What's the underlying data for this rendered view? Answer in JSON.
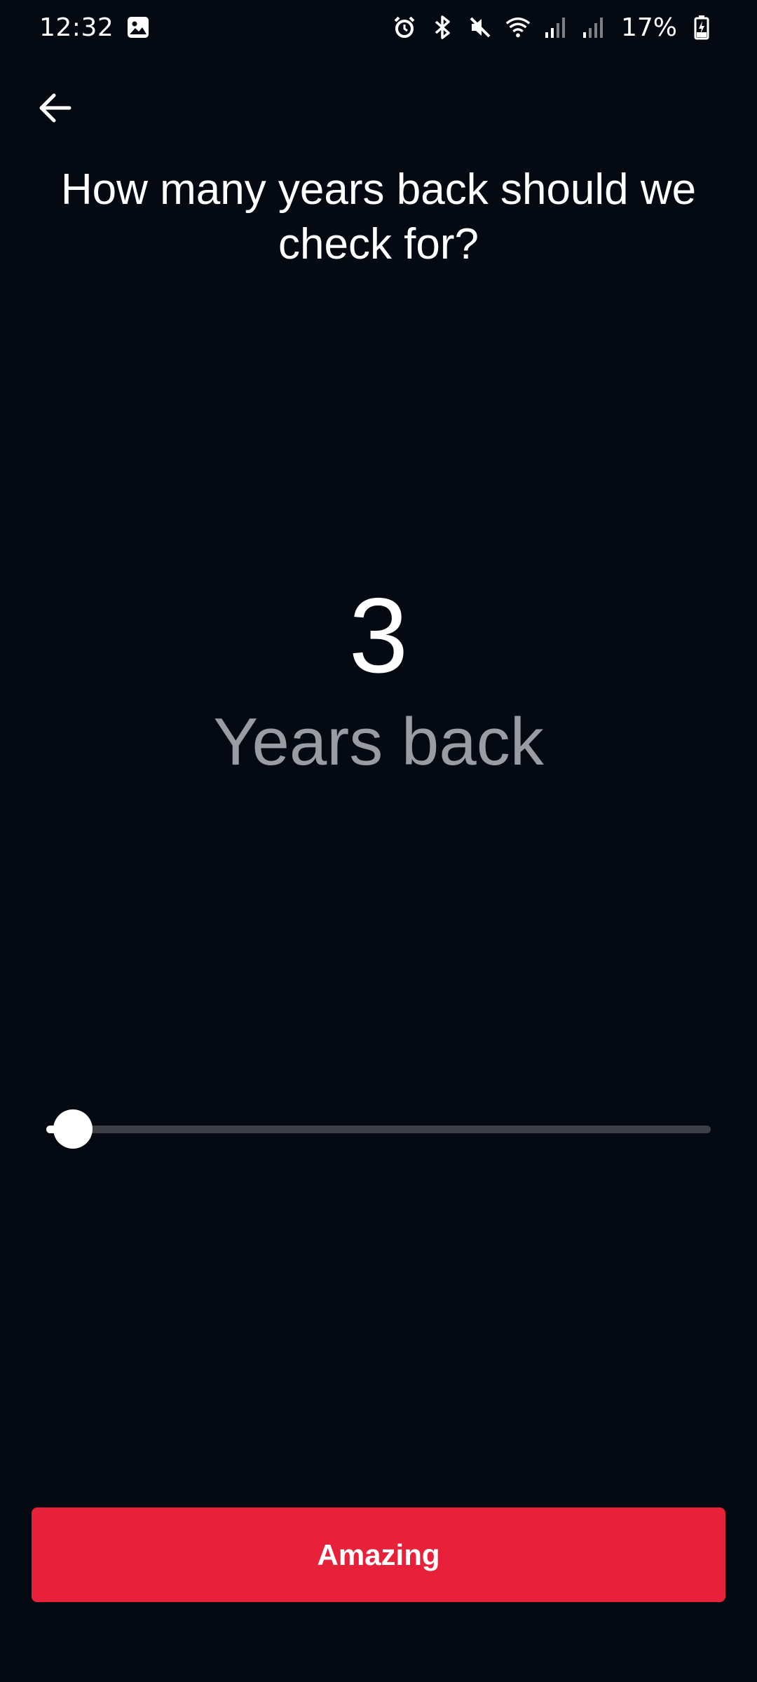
{
  "status_bar": {
    "time": "12:32",
    "battery": "17%",
    "icons": [
      "image-icon",
      "alarm-icon",
      "bluetooth-icon",
      "mute-icon",
      "wifi-icon",
      "signal-icon",
      "signal-icon",
      "battery-charging-icon"
    ]
  },
  "header": {
    "back_icon": "arrow-left-icon",
    "title": "How many years back should we check for?"
  },
  "selection": {
    "value": "3",
    "unit_label": "Years back"
  },
  "slider": {
    "level": 0.04
  },
  "footer": {
    "button_label": "Amazing"
  },
  "colors": {
    "background": "#050a12",
    "accent": "#e8213a",
    "track": "#3d3f44",
    "muted_text": "#9a9ca3"
  }
}
